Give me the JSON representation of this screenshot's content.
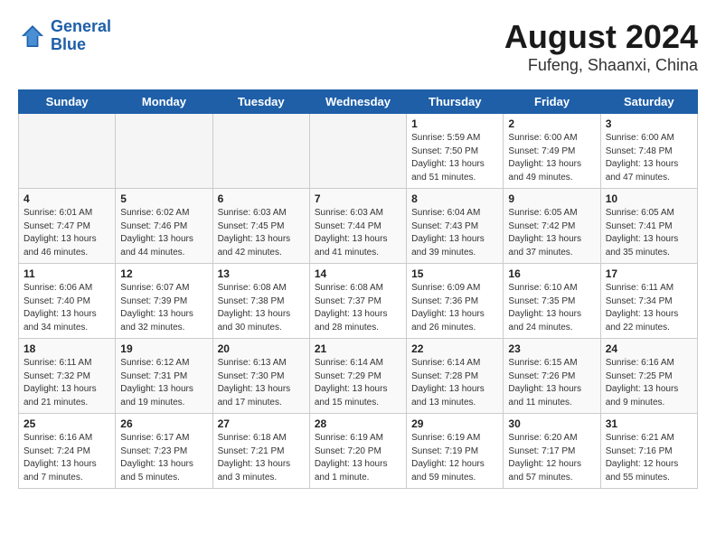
{
  "header": {
    "logo_line1": "General",
    "logo_line2": "Blue",
    "title": "August 2024",
    "subtitle": "Fufeng, Shaanxi, China"
  },
  "days_of_week": [
    "Sunday",
    "Monday",
    "Tuesday",
    "Wednesday",
    "Thursday",
    "Friday",
    "Saturday"
  ],
  "weeks": [
    [
      {
        "num": "",
        "detail": "",
        "empty": true
      },
      {
        "num": "",
        "detail": "",
        "empty": true
      },
      {
        "num": "",
        "detail": "",
        "empty": true
      },
      {
        "num": "",
        "detail": "",
        "empty": true
      },
      {
        "num": "1",
        "detail": "Sunrise: 5:59 AM\nSunset: 7:50 PM\nDaylight: 13 hours\nand 51 minutes.",
        "empty": false
      },
      {
        "num": "2",
        "detail": "Sunrise: 6:00 AM\nSunset: 7:49 PM\nDaylight: 13 hours\nand 49 minutes.",
        "empty": false
      },
      {
        "num": "3",
        "detail": "Sunrise: 6:00 AM\nSunset: 7:48 PM\nDaylight: 13 hours\nand 47 minutes.",
        "empty": false
      }
    ],
    [
      {
        "num": "4",
        "detail": "Sunrise: 6:01 AM\nSunset: 7:47 PM\nDaylight: 13 hours\nand 46 minutes.",
        "empty": false
      },
      {
        "num": "5",
        "detail": "Sunrise: 6:02 AM\nSunset: 7:46 PM\nDaylight: 13 hours\nand 44 minutes.",
        "empty": false
      },
      {
        "num": "6",
        "detail": "Sunrise: 6:03 AM\nSunset: 7:45 PM\nDaylight: 13 hours\nand 42 minutes.",
        "empty": false
      },
      {
        "num": "7",
        "detail": "Sunrise: 6:03 AM\nSunset: 7:44 PM\nDaylight: 13 hours\nand 41 minutes.",
        "empty": false
      },
      {
        "num": "8",
        "detail": "Sunrise: 6:04 AM\nSunset: 7:43 PM\nDaylight: 13 hours\nand 39 minutes.",
        "empty": false
      },
      {
        "num": "9",
        "detail": "Sunrise: 6:05 AM\nSunset: 7:42 PM\nDaylight: 13 hours\nand 37 minutes.",
        "empty": false
      },
      {
        "num": "10",
        "detail": "Sunrise: 6:05 AM\nSunset: 7:41 PM\nDaylight: 13 hours\nand 35 minutes.",
        "empty": false
      }
    ],
    [
      {
        "num": "11",
        "detail": "Sunrise: 6:06 AM\nSunset: 7:40 PM\nDaylight: 13 hours\nand 34 minutes.",
        "empty": false
      },
      {
        "num": "12",
        "detail": "Sunrise: 6:07 AM\nSunset: 7:39 PM\nDaylight: 13 hours\nand 32 minutes.",
        "empty": false
      },
      {
        "num": "13",
        "detail": "Sunrise: 6:08 AM\nSunset: 7:38 PM\nDaylight: 13 hours\nand 30 minutes.",
        "empty": false
      },
      {
        "num": "14",
        "detail": "Sunrise: 6:08 AM\nSunset: 7:37 PM\nDaylight: 13 hours\nand 28 minutes.",
        "empty": false
      },
      {
        "num": "15",
        "detail": "Sunrise: 6:09 AM\nSunset: 7:36 PM\nDaylight: 13 hours\nand 26 minutes.",
        "empty": false
      },
      {
        "num": "16",
        "detail": "Sunrise: 6:10 AM\nSunset: 7:35 PM\nDaylight: 13 hours\nand 24 minutes.",
        "empty": false
      },
      {
        "num": "17",
        "detail": "Sunrise: 6:11 AM\nSunset: 7:34 PM\nDaylight: 13 hours\nand 22 minutes.",
        "empty": false
      }
    ],
    [
      {
        "num": "18",
        "detail": "Sunrise: 6:11 AM\nSunset: 7:32 PM\nDaylight: 13 hours\nand 21 minutes.",
        "empty": false
      },
      {
        "num": "19",
        "detail": "Sunrise: 6:12 AM\nSunset: 7:31 PM\nDaylight: 13 hours\nand 19 minutes.",
        "empty": false
      },
      {
        "num": "20",
        "detail": "Sunrise: 6:13 AM\nSunset: 7:30 PM\nDaylight: 13 hours\nand 17 minutes.",
        "empty": false
      },
      {
        "num": "21",
        "detail": "Sunrise: 6:14 AM\nSunset: 7:29 PM\nDaylight: 13 hours\nand 15 minutes.",
        "empty": false
      },
      {
        "num": "22",
        "detail": "Sunrise: 6:14 AM\nSunset: 7:28 PM\nDaylight: 13 hours\nand 13 minutes.",
        "empty": false
      },
      {
        "num": "23",
        "detail": "Sunrise: 6:15 AM\nSunset: 7:26 PM\nDaylight: 13 hours\nand 11 minutes.",
        "empty": false
      },
      {
        "num": "24",
        "detail": "Sunrise: 6:16 AM\nSunset: 7:25 PM\nDaylight: 13 hours\nand 9 minutes.",
        "empty": false
      }
    ],
    [
      {
        "num": "25",
        "detail": "Sunrise: 6:16 AM\nSunset: 7:24 PM\nDaylight: 13 hours\nand 7 minutes.",
        "empty": false
      },
      {
        "num": "26",
        "detail": "Sunrise: 6:17 AM\nSunset: 7:23 PM\nDaylight: 13 hours\nand 5 minutes.",
        "empty": false
      },
      {
        "num": "27",
        "detail": "Sunrise: 6:18 AM\nSunset: 7:21 PM\nDaylight: 13 hours\nand 3 minutes.",
        "empty": false
      },
      {
        "num": "28",
        "detail": "Sunrise: 6:19 AM\nSunset: 7:20 PM\nDaylight: 13 hours\nand 1 minute.",
        "empty": false
      },
      {
        "num": "29",
        "detail": "Sunrise: 6:19 AM\nSunset: 7:19 PM\nDaylight: 12 hours\nand 59 minutes.",
        "empty": false
      },
      {
        "num": "30",
        "detail": "Sunrise: 6:20 AM\nSunset: 7:17 PM\nDaylight: 12 hours\nand 57 minutes.",
        "empty": false
      },
      {
        "num": "31",
        "detail": "Sunrise: 6:21 AM\nSunset: 7:16 PM\nDaylight: 12 hours\nand 55 minutes.",
        "empty": false
      }
    ]
  ]
}
